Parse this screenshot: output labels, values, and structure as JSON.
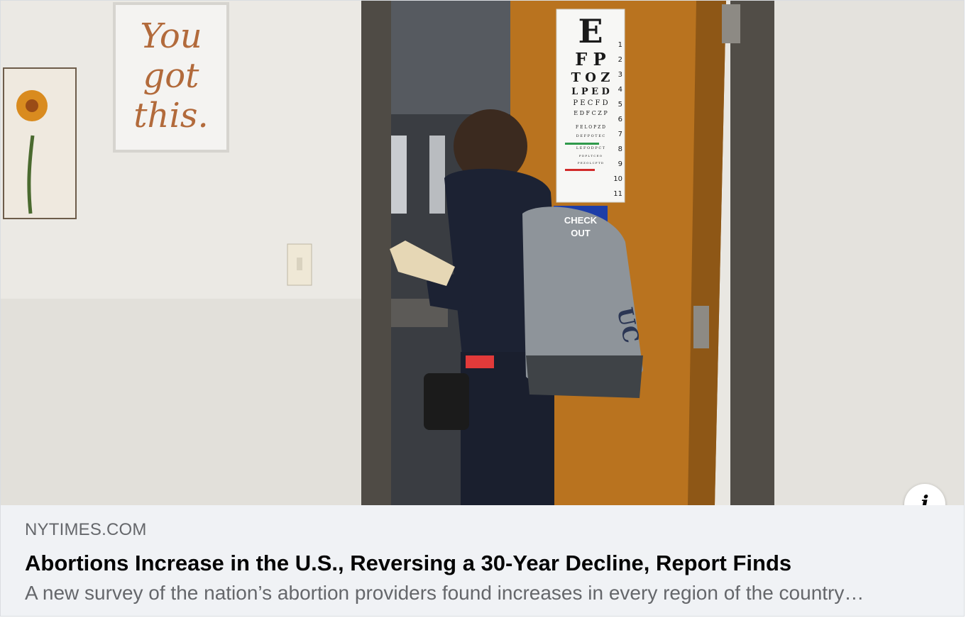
{
  "link_preview": {
    "image": {
      "wall_sign_text": [
        "You",
        "got",
        "this."
      ],
      "eye_chart_rows": [
        "E",
        "F P",
        "T O Z",
        "L P E D",
        "P E C F D",
        "E D F C Z P",
        "F E L O P Z D",
        "D E F P O T E C",
        "L E F O D P C T",
        "F D P L T C E O",
        "P E Z O L C F T D"
      ],
      "eye_chart_numbers": [
        "1",
        "2",
        "3",
        "4",
        "5",
        "6",
        "7",
        "8",
        "9",
        "10",
        "11"
      ],
      "door_sign_text": "CHECK OUT",
      "backpack_logo_text": "UC"
    },
    "domain": "NYTIMES.COM",
    "headline": "Abortions Increase in the U.S., Reversing a 30-Year Decline, Report Finds",
    "description": "A new survey of the nation’s abortion providers found increases in every region of the country…",
    "info_button_icon": "info-icon"
  }
}
